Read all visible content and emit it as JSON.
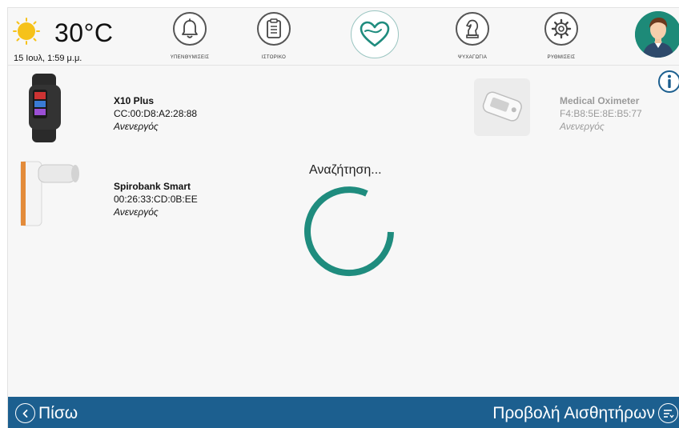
{
  "header": {
    "weather": {
      "icon": "sun-icon",
      "temperature": "30°C",
      "datetime": "15 Ιουλ, 1:59 μ.μ."
    },
    "nav": [
      {
        "label": "ΥΠΕΝΘΥΜΙΣΕΙΣ",
        "icon": "bell-icon"
      },
      {
        "label": "ΙΣΤΟΡΙΚΟ",
        "icon": "clipboard-icon"
      },
      {
        "label": "",
        "icon": "heart-icon"
      },
      {
        "label": "ΨΥΧΑΓΩΓΙΑ",
        "icon": "chess-knight-icon"
      },
      {
        "label": "ΡΥΘΜΙΣΕΙΣ",
        "icon": "gear-icon"
      }
    ],
    "avatar_icon": "user-avatar-icon"
  },
  "devices": [
    {
      "name": "X10 Plus",
      "mac": "CC:00:D8:A2:28:88",
      "status": "Ανενεργός",
      "icon": "smartwatch-icon",
      "dimmed": false
    },
    {
      "name": "Medical Oximeter",
      "mac": "F4:B8:5E:8E:B5:77",
      "status": "Ανενεργός",
      "icon": "oximeter-icon",
      "dimmed": true
    },
    {
      "name": "Spirobank Smart",
      "mac": "00:26:33:CD:0B:EE",
      "status": "Ανενεργός",
      "icon": "spirometer-icon",
      "dimmed": false
    }
  ],
  "search": {
    "label": "Αναζήτηση..."
  },
  "footer": {
    "back_label": "Πίσω",
    "sensors_label": "Προβολή Αισθητήρων"
  },
  "colors": {
    "teal": "#1f8c7e",
    "footer": "#1c5f8f",
    "sun": "#f6c21a",
    "avatar": "#1d8a78"
  }
}
